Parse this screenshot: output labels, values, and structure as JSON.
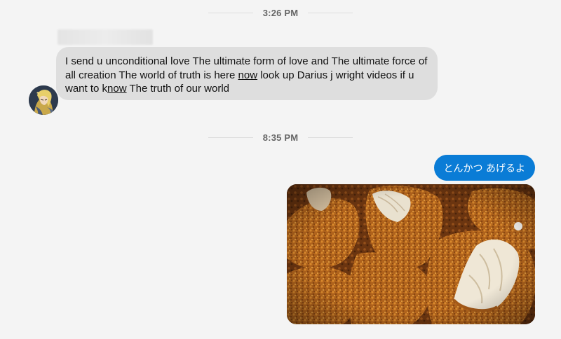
{
  "timestamps": {
    "first": "3:26 PM",
    "second": "8:35 PM"
  },
  "incoming_message": {
    "part1": "I send u unconditional love The ultimate form of love and The ultimate force of all creation The world of truth is here ",
    "link1": "now",
    "part2": " look up Darius j wright videos if u want to k",
    "link2": "now",
    "part3": " The truth of our world"
  },
  "outgoing_message": {
    "text": "とんかつ あげるよ",
    "bubble_color": "#0a7cd6"
  },
  "attachment": {
    "type": "photo",
    "subject": "fried tonkatsu pieces"
  },
  "icons": {
    "avatar": "user-avatar-anime-character"
  }
}
